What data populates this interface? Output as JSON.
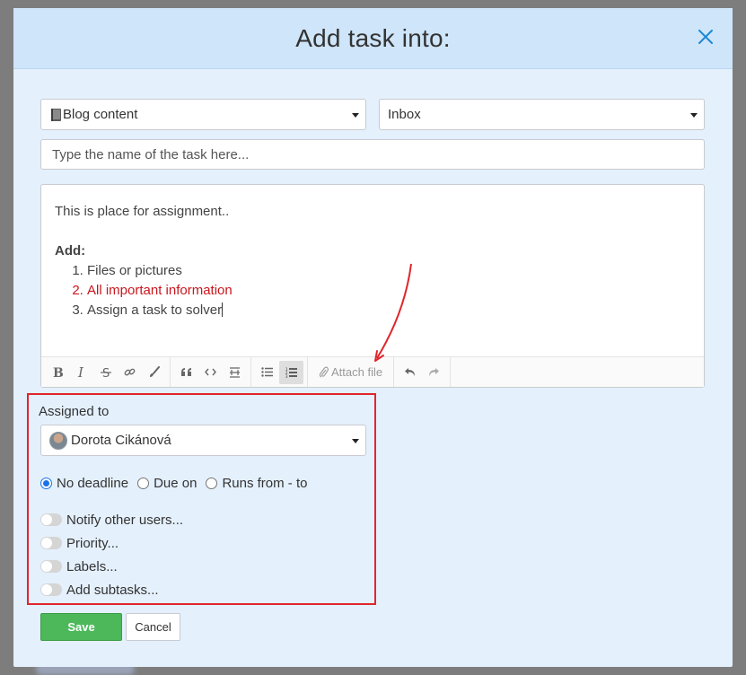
{
  "modal": {
    "title": "Add task into:",
    "close_icon": "close-icon"
  },
  "form": {
    "project_select": {
      "value": "Blog content",
      "icon": "book-icon"
    },
    "list_select": {
      "value": "Inbox"
    },
    "task_name": {
      "value": "",
      "placeholder": "Type the name of the task here..."
    }
  },
  "editor": {
    "intro": "This is place for assignment..",
    "add_label": "Add:",
    "items": [
      {
        "text": "Files or pictures",
        "color": "#444444"
      },
      {
        "text": "All important information",
        "color": "#c9171e"
      },
      {
        "text": "Assign a task to solver",
        "color": "#444444"
      }
    ],
    "toolbar": {
      "format_buttons": [
        "bold-icon",
        "italic-icon",
        "strikethrough-icon",
        "link-icon",
        "brush-icon"
      ],
      "insert_buttons": [
        "quote-icon",
        "code-icon",
        "horizontal-rule-icon"
      ],
      "list_buttons": [
        "bullet-list-icon",
        "numbered-list-icon"
      ],
      "attach_label": "Attach file",
      "history_buttons": [
        "undo-icon",
        "redo-icon"
      ]
    }
  },
  "assignment": {
    "label": "Assigned to",
    "assignee": "Dorota Cikánová",
    "deadline_options": [
      {
        "label": "No deadline",
        "checked": true
      },
      {
        "label": "Due on",
        "checked": false
      },
      {
        "label": "Runs from - to",
        "checked": false
      }
    ],
    "toggles": [
      {
        "label": "Notify other users...",
        "on": false
      },
      {
        "label": "Priority...",
        "on": false
      },
      {
        "label": "Labels...",
        "on": false
      },
      {
        "label": "Add subtasks...",
        "on": false
      }
    ]
  },
  "actions": {
    "save_label": "Save",
    "cancel_label": "Cancel"
  },
  "colors": {
    "accent": "#1a73e8",
    "save": "#4cb85a",
    "highlight_box": "#e0252b",
    "header_bg": "#cfe5f9",
    "modal_bg": "#e4f0fc"
  }
}
